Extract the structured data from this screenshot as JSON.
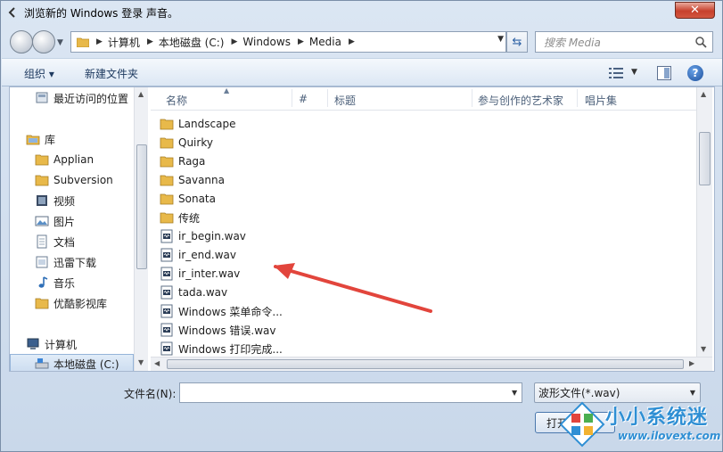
{
  "window": {
    "title": "浏览新的 Windows 登录 声音。",
    "close_label": "✕"
  },
  "address": {
    "crumbs": [
      "计算机",
      "本地磁盘 (C:)",
      "Windows",
      "Media"
    ]
  },
  "search": {
    "placeholder": "搜索 Media"
  },
  "toolbar": {
    "organize_label": "组织 ▾",
    "new_folder_label": "新建文件夹",
    "help_label": "?"
  },
  "sidebar": {
    "items": [
      {
        "label": "最近访问的位置",
        "icon": "recent-places-icon"
      },
      {
        "label": "库",
        "icon": "library-icon"
      },
      {
        "label": "Applian",
        "icon": "folder-icon"
      },
      {
        "label": "Subversion",
        "icon": "folder-icon"
      },
      {
        "label": "视频",
        "icon": "video-icon"
      },
      {
        "label": "图片",
        "icon": "picture-icon"
      },
      {
        "label": "文档",
        "icon": "document-icon"
      },
      {
        "label": "迅雷下载",
        "icon": "download-icon"
      },
      {
        "label": "音乐",
        "icon": "music-icon"
      },
      {
        "label": "优酷影视库",
        "icon": "folder-icon"
      },
      {
        "label": "计算机",
        "icon": "computer-icon"
      },
      {
        "label": "本地磁盘 (C:)",
        "icon": "drive-icon"
      }
    ]
  },
  "columns": {
    "name": "名称",
    "number": "#",
    "title": "标题",
    "artist": "参与创作的艺术家",
    "album": "唱片集"
  },
  "files": [
    {
      "name": "Landscape",
      "type": "folder"
    },
    {
      "name": "Quirky",
      "type": "folder"
    },
    {
      "name": "Raga",
      "type": "folder"
    },
    {
      "name": "Savanna",
      "type": "folder"
    },
    {
      "name": "Sonata",
      "type": "folder"
    },
    {
      "name": "传统",
      "type": "folder"
    },
    {
      "name": "ir_begin.wav",
      "type": "wav"
    },
    {
      "name": "ir_end.wav",
      "type": "wav"
    },
    {
      "name": "ir_inter.wav",
      "type": "wav"
    },
    {
      "name": "tada.wav",
      "type": "wav"
    },
    {
      "name": "Windows 菜单命令...",
      "type": "wav"
    },
    {
      "name": "Windows 错误.wav",
      "type": "wav"
    },
    {
      "name": "Windows 打印完成...",
      "type": "wav"
    }
  ],
  "footer": {
    "filename_label": "文件名(N):",
    "filename_value": "",
    "filter_value": "波形文件(*.wav)",
    "open_label": "打开(O)"
  },
  "watermark": {
    "brand": "小小系统迷",
    "url": "www.ilovext.com"
  },
  "colors": {
    "accent": "#2f8fd4",
    "annotation_arrow": "#e2453c",
    "folder": "#e8b94a"
  }
}
